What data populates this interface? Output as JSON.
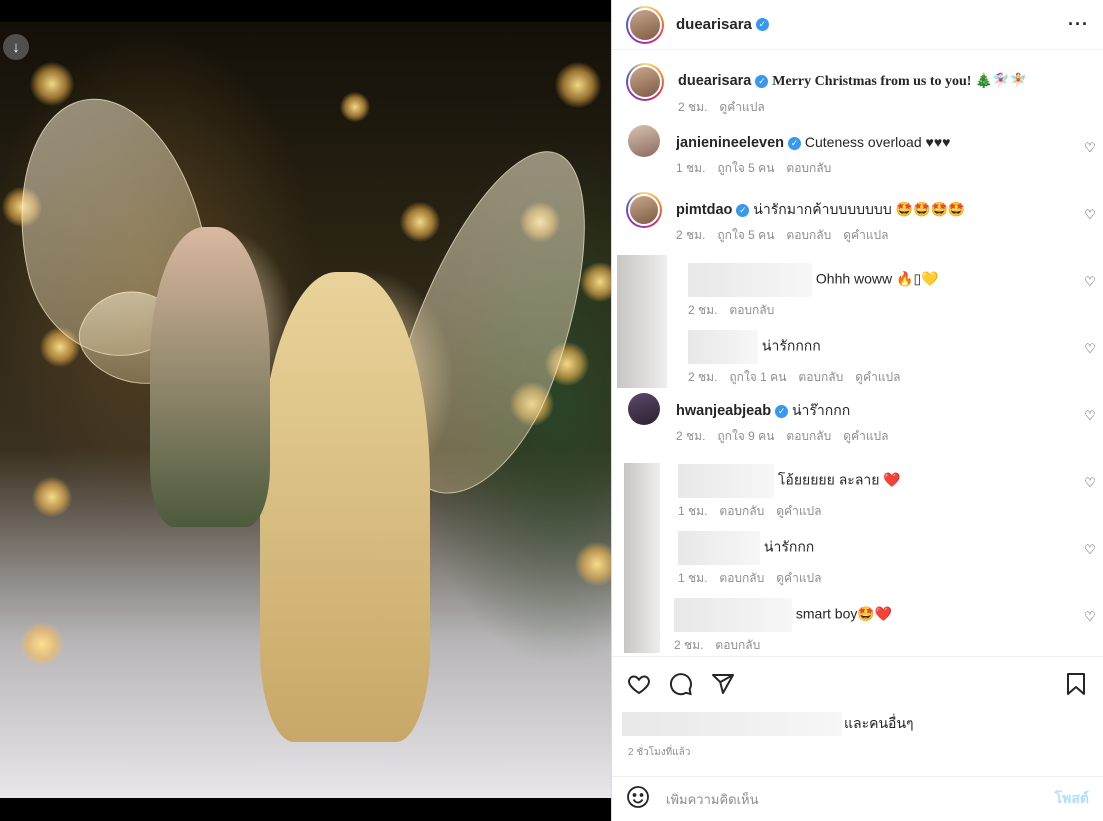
{
  "post": {
    "author": "duearisara",
    "caption": "Merry Christmas from us to you! 🎄🧚🏻‍♀️🧚🏻",
    "caption_time": "2 ชม.",
    "caption_translate": "ดูคำแปล"
  },
  "comments": [
    {
      "user": "janienineeleven",
      "text": "Cuteness overload ♥♥♥",
      "time": "1 ชม.",
      "likes": "ถูกใจ 5 คน",
      "reply": "ตอบกลับ",
      "translate": ""
    },
    {
      "user": "pimtdao",
      "text": "น่ารักมากค้าบบบบบบบ 🤩🤩🤩🤩",
      "time": "2 ชม.",
      "likes": "ถูกใจ 5 คน",
      "reply": "ตอบกลับ",
      "translate": "ดูคำแปล"
    },
    {
      "user": "",
      "text": "Ohhh woww 🔥▯💛",
      "time": "2 ชม.",
      "likes": "",
      "reply": "ตอบกลับ",
      "translate": ""
    },
    {
      "user": "",
      "text": "น่ารักกกก",
      "time": "2 ชม.",
      "likes": "ถูกใจ 1 คน",
      "reply": "ตอบกลับ",
      "translate": "ดูคำแปล"
    },
    {
      "user": "hwanjeabjeab",
      "text": "น่าร๊ากกก",
      "time": "2 ชม.",
      "likes": "ถูกใจ 9 คน",
      "reply": "ตอบกลับ",
      "translate": "ดูคำแปล"
    },
    {
      "user": "",
      "text": "โอ้ยยยยย ละลาย ❤️",
      "time": "1 ชม.",
      "likes": "",
      "reply": "ตอบกลับ",
      "translate": "ดูคำแปล"
    },
    {
      "user": "",
      "text": "น่ารักกก",
      "time": "1 ชม.",
      "likes": "",
      "reply": "ตอบกลับ",
      "translate": "ดูคำแปล"
    },
    {
      "user": "",
      "text": "smart boy🤩❤️",
      "time": "2 ชม.",
      "likes": "",
      "reply": "ตอบกลับ",
      "translate": ""
    }
  ],
  "likes_suffix": "และคนอื่นๆ",
  "post_time": "2 ชั่วโมงที่แล้ว",
  "composer": {
    "placeholder": "เพิ่มความคิดเห็น",
    "post_label": "โพสต์"
  },
  "icons": {
    "verified": "verified-badge-icon",
    "more": "more-options-icon",
    "like": "heart-icon",
    "comment": "comment-icon",
    "share": "share-icon",
    "save": "bookmark-icon",
    "emoji": "emoji-icon",
    "download": "download-icon"
  },
  "colors": {
    "verified": "#3897f0",
    "post_button": "#b2dffc",
    "muted_text": "#8e8e8e"
  }
}
